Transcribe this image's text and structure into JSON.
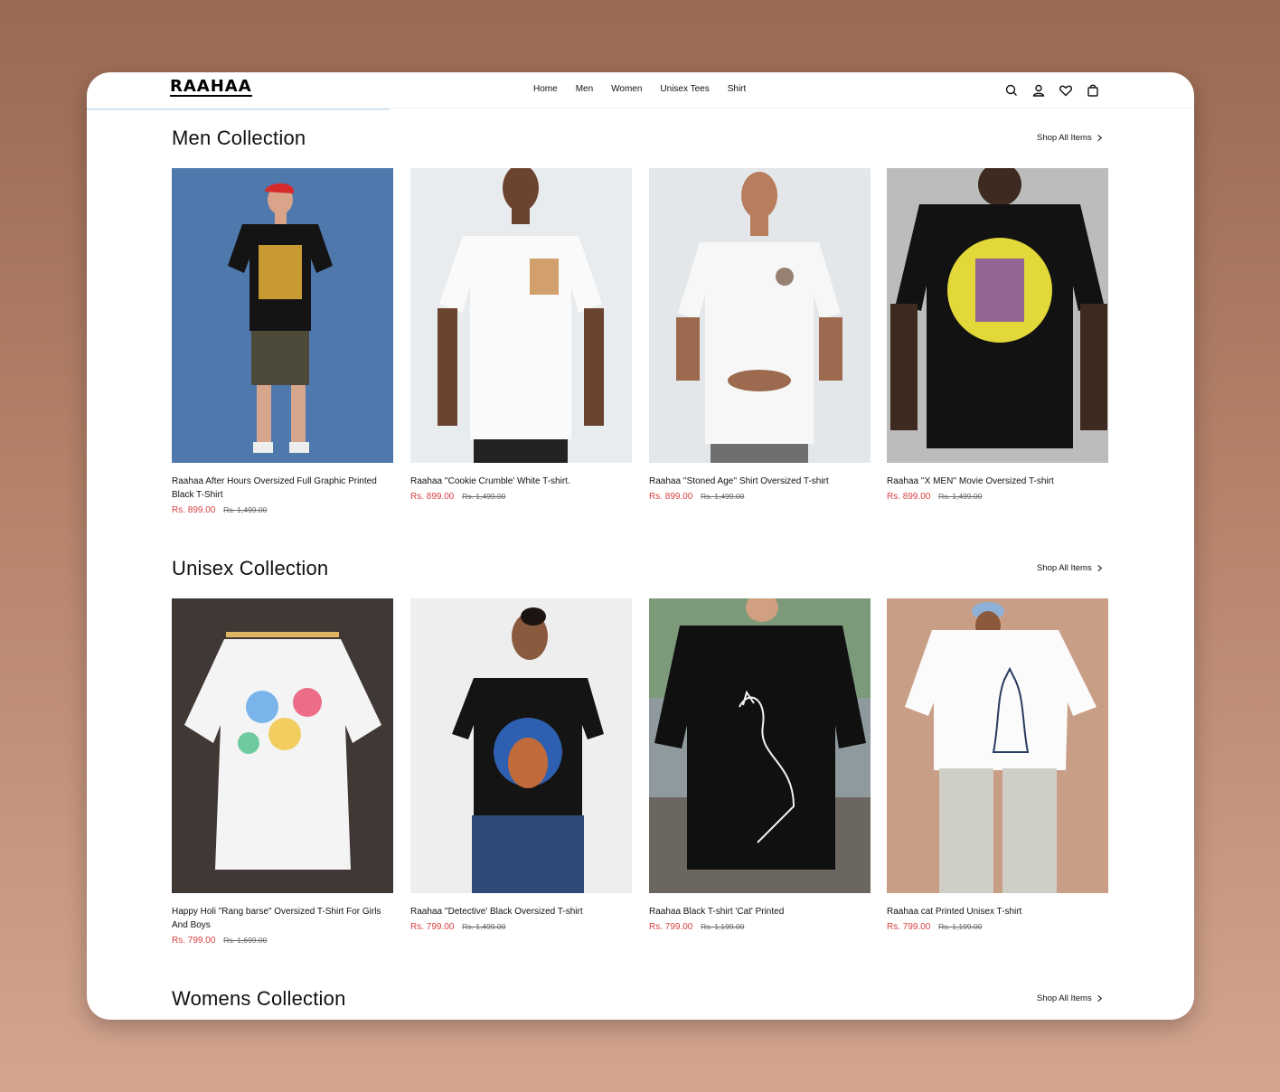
{
  "brand": {
    "logo": "RAAHAA"
  },
  "nav": {
    "items": [
      "Home",
      "Men",
      "Women",
      "Unisex Tees",
      "Shirt"
    ]
  },
  "header_icons": [
    "search-icon",
    "user-icon",
    "heart-icon",
    "bag-icon"
  ],
  "sections": [
    {
      "title": "Men Collection",
      "shop_all": "Shop All Items",
      "products": [
        {
          "name": "Raahaa After Hours Oversized Full Graphic Printed Black T-Shirt",
          "price": "Rs. 899.00",
          "compare": "Rs. 1,499.00",
          "bg": "#4f79ad",
          "shirt": "#141414"
        },
        {
          "name": "Raahaa ''Cookie Crumble' White T-shirt.",
          "price": "Rs. 899.00",
          "compare": "Rs. 1,499.00",
          "bg": "#e9ecee",
          "shirt": "#fafafa"
        },
        {
          "name": "Raahaa ''Stoned Age'' Shirt Oversized T-shirt",
          "price": "Rs. 899.00",
          "compare": "Rs. 1,499.00",
          "bg": "#e4e7e9",
          "shirt": "#f7f7f7"
        },
        {
          "name": "Raahaa ''X MEN'' Movie Oversized T-shirt",
          "price": "Rs. 899.00",
          "compare": "Rs. 1,499.00",
          "bg": "#bcbcbc",
          "shirt": "#121212"
        }
      ]
    },
    {
      "title": "Unisex Collection",
      "shop_all": "Shop All Items",
      "products": [
        {
          "name": "Happy Holi \"Rang barse\" Oversized T-Shirt For Girls And Boys",
          "price": "Rs. 799.00",
          "compare": "Rs. 1,699.00",
          "bg": "#3f3835",
          "shirt": "#f4f4f4"
        },
        {
          "name": "Raahaa ''Detective' Black Oversized T-shirt",
          "price": "Rs. 799.00",
          "compare": "Rs. 1,499.00",
          "bg": "#eeeeee",
          "shirt": "#141414"
        },
        {
          "name": "Raahaa Black T-shirt 'Cat' Printed",
          "price": "Rs. 799.00",
          "compare": "Rs. 1,199.00",
          "bg": "#8e9a9e",
          "shirt": "#101010"
        },
        {
          "name": "Raahaa cat Printed Unisex T-shirt",
          "price": "Rs. 799.00",
          "compare": "Rs. 1,199.00",
          "bg": "#c99e86",
          "shirt": "#fbfbfb"
        }
      ]
    },
    {
      "title": "Womens Collection",
      "shop_all": "Shop All Items",
      "products": []
    }
  ]
}
